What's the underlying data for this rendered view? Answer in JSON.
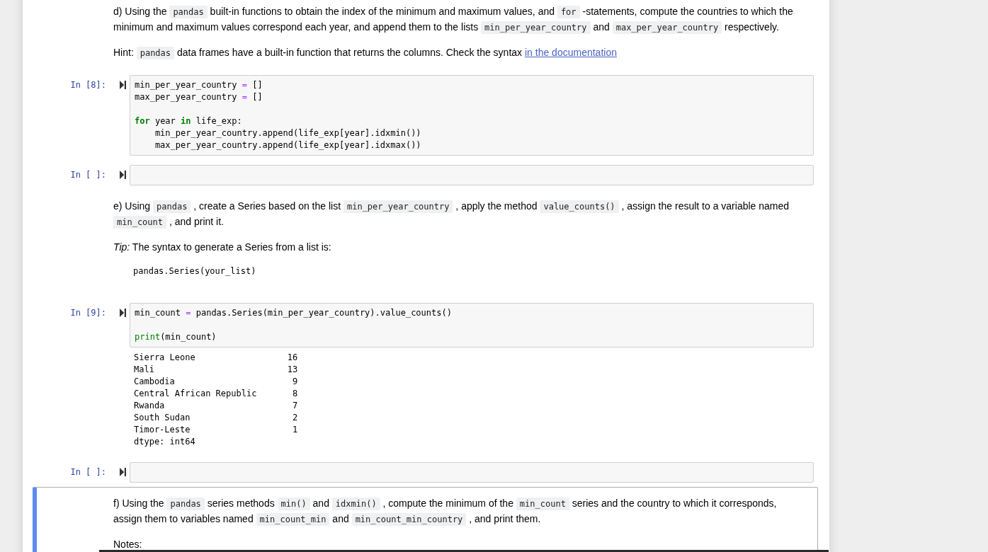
{
  "cells": [
    {
      "kind": "markdown",
      "selected": false,
      "blocks": [
        {
          "kind": "paragraph",
          "parts": [
            {
              "kind": "text",
              "text": "d) Using the "
            },
            {
              "kind": "code",
              "text": "pandas"
            },
            {
              "kind": "text",
              "text": " built-in functions to obtain the index of the minimum and maximum values, and "
            },
            {
              "kind": "code",
              "text": "for"
            },
            {
              "kind": "text",
              "text": " -statements, compute the countries to which the minimum and maximum values correspond each year, and append them to the lists "
            },
            {
              "kind": "code",
              "text": "min_per_year_country"
            },
            {
              "kind": "text",
              "text": " and "
            },
            {
              "kind": "code",
              "text": "max_per_year_country"
            },
            {
              "kind": "text",
              "text": " respectively."
            }
          ]
        },
        {
          "kind": "paragraph",
          "parts": [
            {
              "kind": "text",
              "text": "Hint: "
            },
            {
              "kind": "code",
              "text": "pandas"
            },
            {
              "kind": "text",
              "text": " data frames have a built-in function that returns the columns. Check the syntax "
            },
            {
              "kind": "link",
              "text": "in the documentation"
            }
          ]
        }
      ]
    },
    {
      "kind": "code",
      "selected": false,
      "prompt": "In [8]:",
      "tokens": [
        {
          "kind": "plain",
          "text": "min_per_year_country "
        },
        {
          "kind": "operator",
          "text": "="
        },
        {
          "kind": "plain",
          "text": " []\nmax_per_year_country "
        },
        {
          "kind": "operator",
          "text": "="
        },
        {
          "kind": "plain",
          "text": " []\n\n"
        },
        {
          "kind": "keyword",
          "text": "for"
        },
        {
          "kind": "plain",
          "text": " year "
        },
        {
          "kind": "keyword",
          "text": "in"
        },
        {
          "kind": "plain",
          "text": " life_exp:\n    min_per_year_country.append(life_exp[year].idxmin())\n    max_per_year_country.append(life_exp[year].idxmax())"
        }
      ]
    },
    {
      "kind": "code",
      "selected": false,
      "prompt": "In [ ]:"
    },
    {
      "kind": "markdown",
      "selected": false,
      "blocks": [
        {
          "kind": "paragraph",
          "parts": [
            {
              "kind": "text",
              "text": "e) Using "
            },
            {
              "kind": "code",
              "text": "pandas"
            },
            {
              "kind": "text",
              "text": " , create a Series based on the list "
            },
            {
              "kind": "code",
              "text": "min_per_year_country"
            },
            {
              "kind": "text",
              "text": " , apply the method "
            },
            {
              "kind": "code",
              "text": "value_counts()"
            },
            {
              "kind": "text",
              "text": " , assign the result to a variable named "
            },
            {
              "kind": "code",
              "text": "min_count"
            },
            {
              "kind": "text",
              "text": " , and print it."
            }
          ]
        },
        {
          "kind": "paragraph",
          "parts": [
            {
              "kind": "em",
              "text": "Tip:"
            },
            {
              "kind": "text",
              "text": " The syntax to generate a Series from a list is:"
            }
          ]
        },
        {
          "kind": "code_block",
          "text": "pandas.Series(your_list)"
        }
      ]
    },
    {
      "kind": "code",
      "selected": false,
      "prompt": "In [9]:",
      "tokens": [
        {
          "kind": "plain",
          "text": "min_count "
        },
        {
          "kind": "operator",
          "text": "="
        },
        {
          "kind": "plain",
          "text": " pandas.Series(min_per_year_country).value_counts()\n\n"
        },
        {
          "kind": "builtin",
          "text": "print"
        },
        {
          "kind": "plain",
          "text": "(min_count)"
        }
      ],
      "output": {
        "rows": [
          {
            "index": "Sierra Leone",
            "value": "16"
          },
          {
            "index": "Mali",
            "value": "13"
          },
          {
            "index": "Cambodia",
            "value": "9"
          },
          {
            "index": "Central African Republic",
            "value": "8"
          },
          {
            "index": "Rwanda",
            "value": "7"
          },
          {
            "index": "South Sudan",
            "value": "2"
          },
          {
            "index": "Timor-Leste",
            "value": "1"
          }
        ],
        "footer": "dtype: int64"
      }
    },
    {
      "kind": "code",
      "selected": false,
      "prompt": "In [ ]:"
    },
    {
      "kind": "markdown",
      "selected": true,
      "blocks": [
        {
          "kind": "paragraph",
          "parts": [
            {
              "kind": "text",
              "text": "f) Using the "
            },
            {
              "kind": "code",
              "text": "pandas"
            },
            {
              "kind": "text",
              "text": " series methods "
            },
            {
              "kind": "code",
              "text": "min()"
            },
            {
              "kind": "text",
              "text": " and "
            },
            {
              "kind": "code",
              "text": "idxmin()"
            },
            {
              "kind": "text",
              "text": " , compute the minimum of the "
            },
            {
              "kind": "code",
              "text": "min_count"
            },
            {
              "kind": "text",
              "text": " series and the country to which it corresponds, assign them to variables named "
            },
            {
              "kind": "code",
              "text": "min_count_min"
            },
            {
              "kind": "text",
              "text": " and "
            },
            {
              "kind": "code",
              "text": "min_count_min_country"
            },
            {
              "kind": "text",
              "text": " , and print them."
            }
          ]
        },
        {
          "kind": "paragraph",
          "parts": [
            {
              "kind": "text",
              "text": "Notes:"
            }
          ]
        }
      ]
    }
  ]
}
